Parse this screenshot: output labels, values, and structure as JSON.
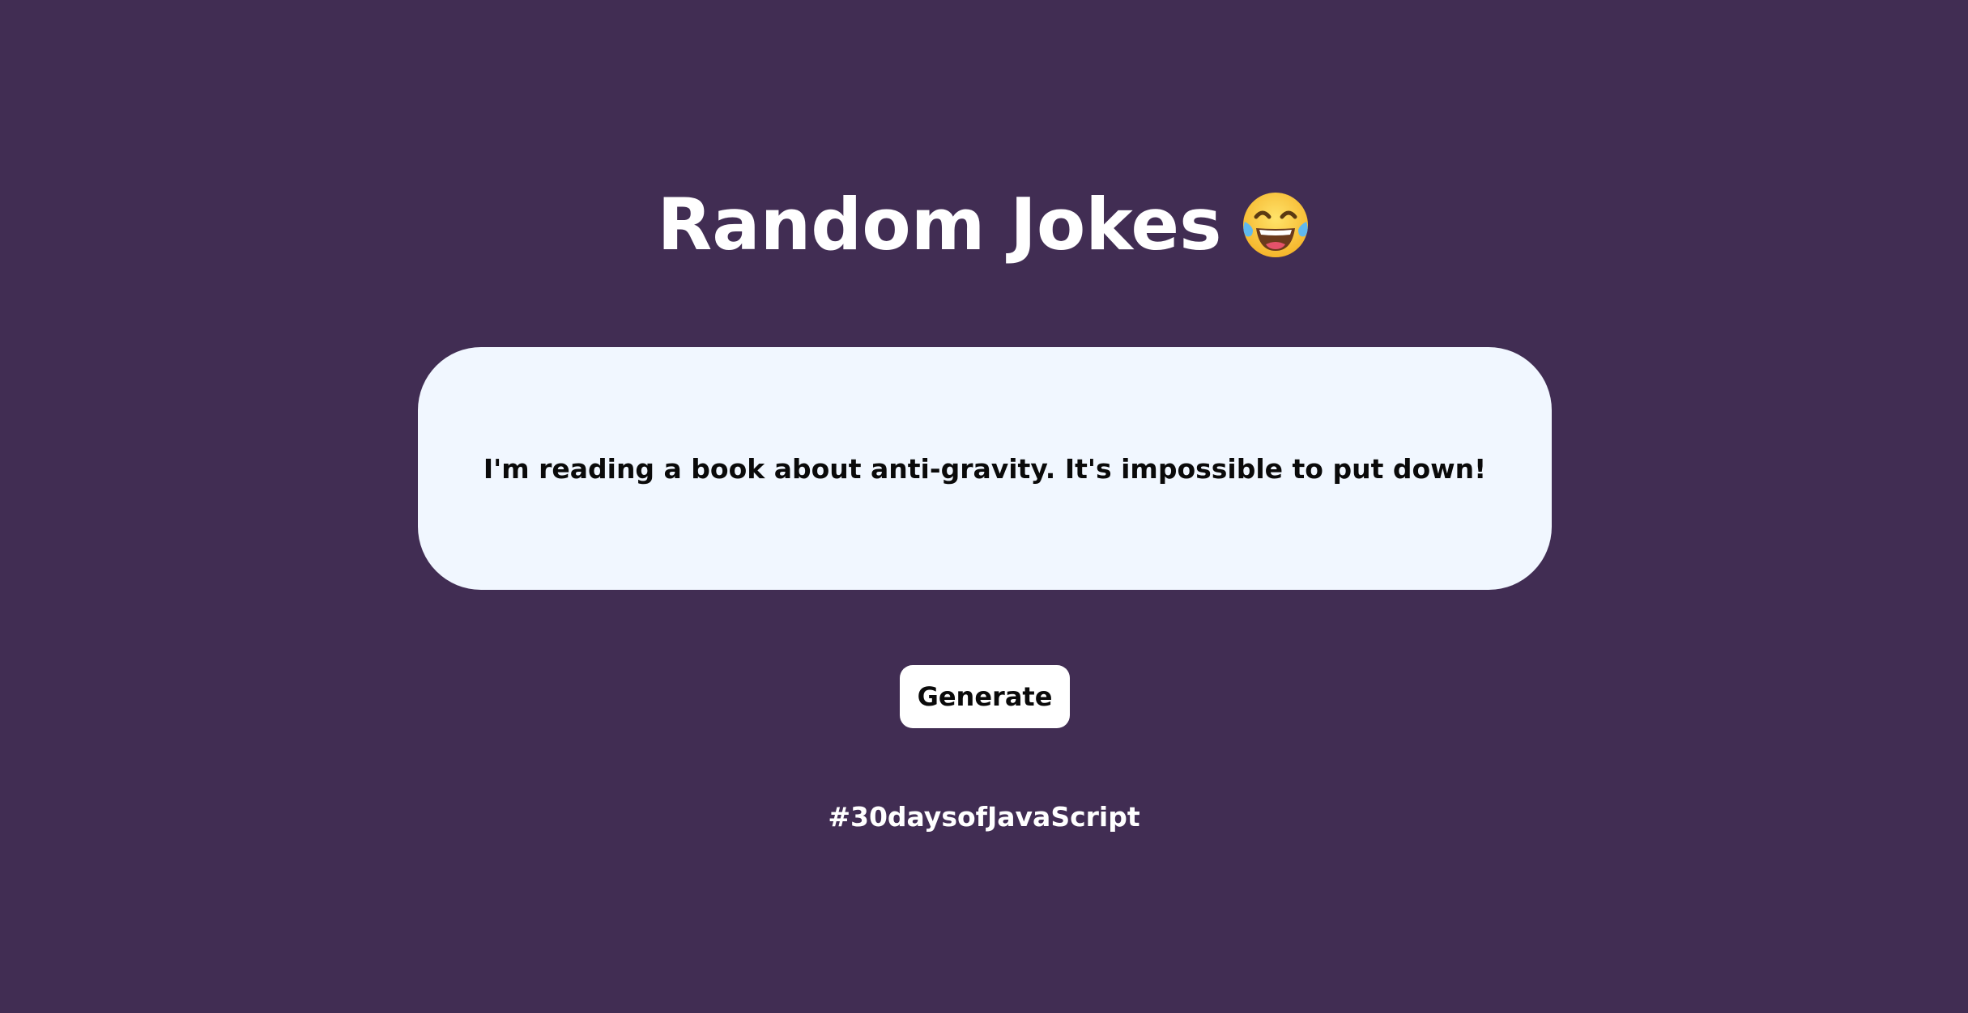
{
  "header": {
    "title": "Random Jokes",
    "emoji_icon": "face-with-tears-of-joy-icon"
  },
  "joke": {
    "text": "I'm reading a book about anti-gravity. It's impossible to put down!"
  },
  "actions": {
    "generate_label": "Generate"
  },
  "footer": {
    "hashtag": "#30daysofJavaScript"
  },
  "colors": {
    "background": "#412d53",
    "card": "#f1f7ff",
    "button": "#ffffff",
    "title_text": "#ffffff",
    "joke_text": "#0a0a0a"
  }
}
